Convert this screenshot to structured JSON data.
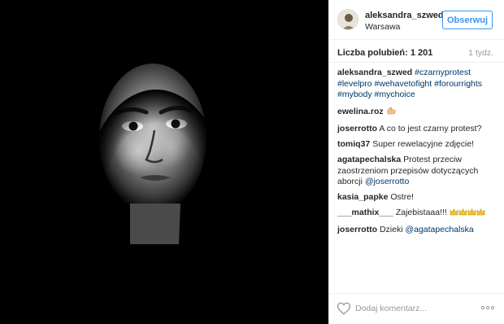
{
  "post": {
    "username": "aleksandra_szwed",
    "location": "Warsawa",
    "follow_label": "Obserwuj",
    "likes_label": "Liczba polubień: 1 201",
    "time_ago": "1 tydz.",
    "comment_placeholder": "Dodaj komentarz..."
  },
  "caption": {
    "user": "aleksandra_szwed",
    "tags": [
      "#czarnyprotest",
      "#levelpro",
      "#wehavetofight",
      "#forourrights",
      "#mybody",
      "#mychoice"
    ]
  },
  "comments": [
    {
      "user": "ewelina.roz",
      "text": "",
      "emoji": "flexed-biceps-emoji"
    },
    {
      "user": "joserrotto",
      "text": "A co to jest czarny protest?"
    },
    {
      "user": "tomiq37",
      "text": "Super rewelacyjne zdjęcie!"
    },
    {
      "user": "agatapechalska",
      "text": "Protest przeciw zaostrzeniom przepisów dotyczących aborcji",
      "mention": "@joserrotto"
    },
    {
      "user": "kasia_papke",
      "text": "Ostre!"
    },
    {
      "user": "___mathix___",
      "text": "Zajebistaaa!!!",
      "emoji": "crown-emoji x4"
    },
    {
      "user": "joserrotto",
      "text": "Dzieki",
      "mention": "@agatapechalska"
    }
  ],
  "colors": {
    "accent": "#3897f0",
    "link": "#003569",
    "muted": "#999999",
    "border": "#efefef",
    "photo_bg": "#000000"
  },
  "icons": {
    "like": "heart-outline-icon",
    "more": "ellipsis-icon"
  }
}
